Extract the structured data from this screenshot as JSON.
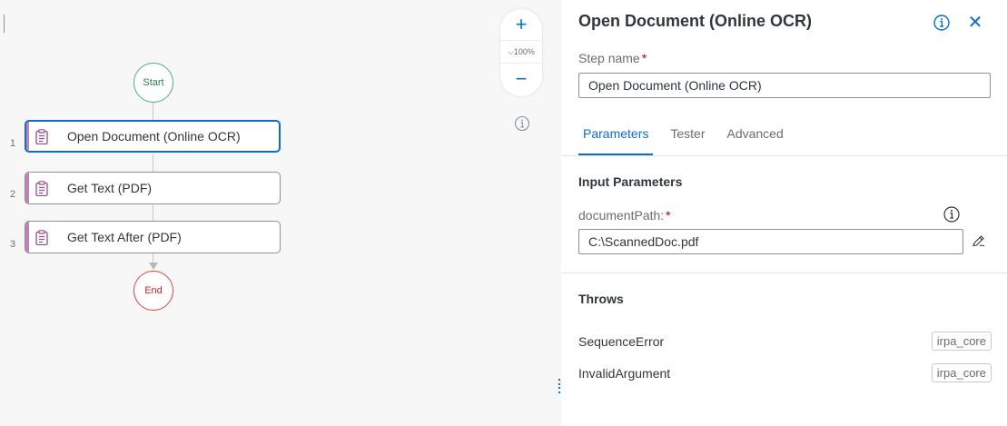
{
  "canvas": {
    "start_label": "Start",
    "end_label": "End",
    "zoom": {
      "in_icon": "+",
      "out_icon": "−",
      "level": "⌵100%"
    },
    "steps": [
      {
        "index": "1",
        "label": "Open Document (Online OCR)",
        "icon": "clipboard-icon",
        "selected": true
      },
      {
        "index": "2",
        "label": "Get Text (PDF)",
        "icon": "clipboard-icon",
        "selected": false
      },
      {
        "index": "3",
        "label": "Get Text After (PDF)",
        "icon": "clipboard-icon",
        "selected": false
      }
    ]
  },
  "panel": {
    "title": "Open Document (Online OCR)",
    "close_icon": "✕",
    "step_name": {
      "label": "Step name",
      "required": "*",
      "value": "Open Document (Online OCR)"
    },
    "tabs": [
      {
        "label": "Parameters",
        "active": true
      },
      {
        "label": "Tester",
        "active": false
      },
      {
        "label": "Advanced",
        "active": false
      }
    ],
    "input_parameters": {
      "title": "Input Parameters",
      "document_path": {
        "label": "documentPath:",
        "required": "*",
        "value": "C:\\ScannedDoc.pdf"
      }
    },
    "throws": {
      "title": "Throws",
      "items": [
        {
          "name": "SequenceError",
          "tag": "irpa_core"
        },
        {
          "name": "InvalidArgument",
          "tag": "irpa_core"
        }
      ]
    }
  },
  "colors": {
    "accent": "#0a6ed1",
    "start_node": "#4caf74",
    "end_node": "#e34040",
    "activity_strip": "#c47fb5",
    "required": "#bb0000"
  }
}
